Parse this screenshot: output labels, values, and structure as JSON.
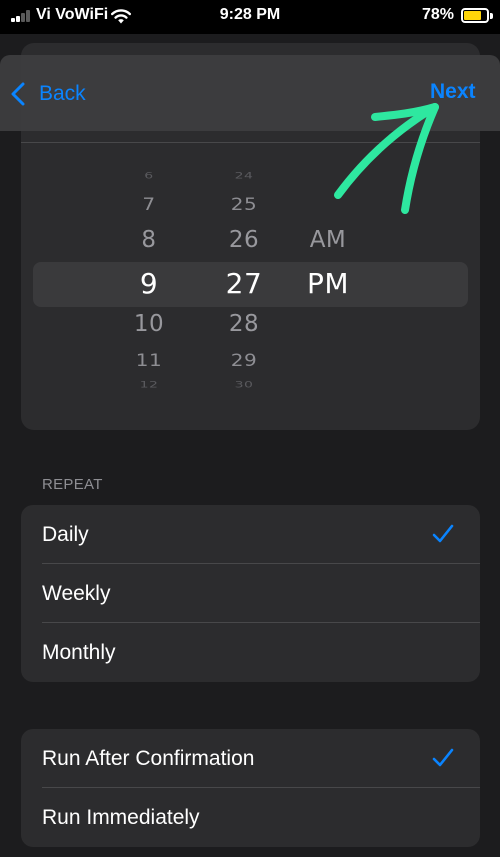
{
  "status_bar": {
    "carrier": "Vi VoWiFi",
    "time": "9:28 PM",
    "battery_percent": "78%",
    "battery_level": 0.78,
    "signal_bars_active": 2
  },
  "nav": {
    "back_label": "Back",
    "next_label": "Next"
  },
  "picker": {
    "hours": [
      "6",
      "7",
      "8",
      "9",
      "10",
      "11",
      "12"
    ],
    "minutes": [
      "24",
      "25",
      "26",
      "27",
      "28",
      "29",
      "30"
    ],
    "periods": [
      "AM",
      "PM"
    ],
    "selected_hour": "9",
    "selected_minute": "27",
    "selected_period": "PM"
  },
  "repeat": {
    "header": "REPEAT",
    "options": [
      {
        "label": "Daily",
        "checked": true
      },
      {
        "label": "Weekly",
        "checked": false
      },
      {
        "label": "Monthly",
        "checked": false
      }
    ]
  },
  "run_mode": {
    "options": [
      {
        "label": "Run After Confirmation",
        "checked": true
      },
      {
        "label": "Run Immediately",
        "checked": false
      }
    ]
  },
  "colors": {
    "accent": "#0a84ff",
    "annotation_arrow": "#2ee8a0",
    "battery": "#ffd60a",
    "background": "#1c1c1e",
    "card": "#2c2c2e"
  },
  "icons": {
    "back": "chevron-left-icon",
    "check": "checkmark-icon",
    "wifi": "wifi-icon",
    "battery": "battery-icon",
    "signal": "cellular-signal-icon"
  }
}
